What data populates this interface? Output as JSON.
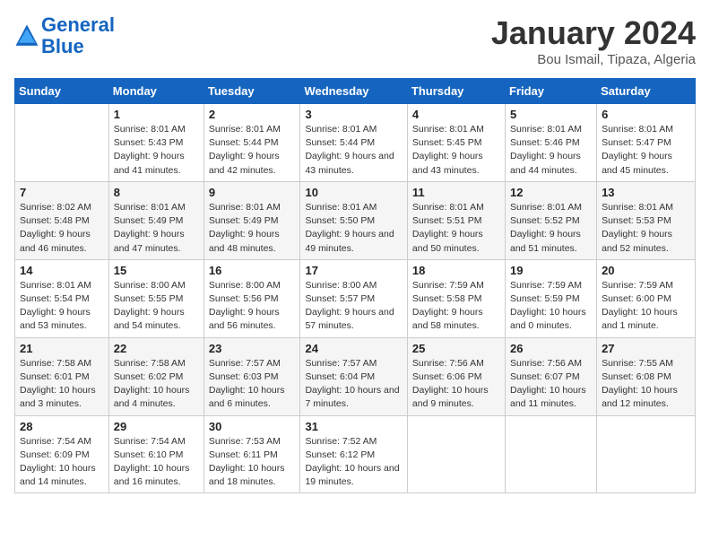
{
  "logo": {
    "line1": "General",
    "line2": "Blue"
  },
  "title": "January 2024",
  "subtitle": "Bou Ismail, Tipaza, Algeria",
  "days_of_week": [
    "Sunday",
    "Monday",
    "Tuesday",
    "Wednesday",
    "Thursday",
    "Friday",
    "Saturday"
  ],
  "weeks": [
    [
      {
        "day": "",
        "sunrise": "",
        "sunset": "",
        "daylight": ""
      },
      {
        "day": "1",
        "sunrise": "Sunrise: 8:01 AM",
        "sunset": "Sunset: 5:43 PM",
        "daylight": "Daylight: 9 hours and 41 minutes."
      },
      {
        "day": "2",
        "sunrise": "Sunrise: 8:01 AM",
        "sunset": "Sunset: 5:44 PM",
        "daylight": "Daylight: 9 hours and 42 minutes."
      },
      {
        "day": "3",
        "sunrise": "Sunrise: 8:01 AM",
        "sunset": "Sunset: 5:44 PM",
        "daylight": "Daylight: 9 hours and 43 minutes."
      },
      {
        "day": "4",
        "sunrise": "Sunrise: 8:01 AM",
        "sunset": "Sunset: 5:45 PM",
        "daylight": "Daylight: 9 hours and 43 minutes."
      },
      {
        "day": "5",
        "sunrise": "Sunrise: 8:01 AM",
        "sunset": "Sunset: 5:46 PM",
        "daylight": "Daylight: 9 hours and 44 minutes."
      },
      {
        "day": "6",
        "sunrise": "Sunrise: 8:01 AM",
        "sunset": "Sunset: 5:47 PM",
        "daylight": "Daylight: 9 hours and 45 minutes."
      }
    ],
    [
      {
        "day": "7",
        "sunrise": "Sunrise: 8:02 AM",
        "sunset": "Sunset: 5:48 PM",
        "daylight": "Daylight: 9 hours and 46 minutes."
      },
      {
        "day": "8",
        "sunrise": "Sunrise: 8:01 AM",
        "sunset": "Sunset: 5:49 PM",
        "daylight": "Daylight: 9 hours and 47 minutes."
      },
      {
        "day": "9",
        "sunrise": "Sunrise: 8:01 AM",
        "sunset": "Sunset: 5:49 PM",
        "daylight": "Daylight: 9 hours and 48 minutes."
      },
      {
        "day": "10",
        "sunrise": "Sunrise: 8:01 AM",
        "sunset": "Sunset: 5:50 PM",
        "daylight": "Daylight: 9 hours and 49 minutes."
      },
      {
        "day": "11",
        "sunrise": "Sunrise: 8:01 AM",
        "sunset": "Sunset: 5:51 PM",
        "daylight": "Daylight: 9 hours and 50 minutes."
      },
      {
        "day": "12",
        "sunrise": "Sunrise: 8:01 AM",
        "sunset": "Sunset: 5:52 PM",
        "daylight": "Daylight: 9 hours and 51 minutes."
      },
      {
        "day": "13",
        "sunrise": "Sunrise: 8:01 AM",
        "sunset": "Sunset: 5:53 PM",
        "daylight": "Daylight: 9 hours and 52 minutes."
      }
    ],
    [
      {
        "day": "14",
        "sunrise": "Sunrise: 8:01 AM",
        "sunset": "Sunset: 5:54 PM",
        "daylight": "Daylight: 9 hours and 53 minutes."
      },
      {
        "day": "15",
        "sunrise": "Sunrise: 8:00 AM",
        "sunset": "Sunset: 5:55 PM",
        "daylight": "Daylight: 9 hours and 54 minutes."
      },
      {
        "day": "16",
        "sunrise": "Sunrise: 8:00 AM",
        "sunset": "Sunset: 5:56 PM",
        "daylight": "Daylight: 9 hours and 56 minutes."
      },
      {
        "day": "17",
        "sunrise": "Sunrise: 8:00 AM",
        "sunset": "Sunset: 5:57 PM",
        "daylight": "Daylight: 9 hours and 57 minutes."
      },
      {
        "day": "18",
        "sunrise": "Sunrise: 7:59 AM",
        "sunset": "Sunset: 5:58 PM",
        "daylight": "Daylight: 9 hours and 58 minutes."
      },
      {
        "day": "19",
        "sunrise": "Sunrise: 7:59 AM",
        "sunset": "Sunset: 5:59 PM",
        "daylight": "Daylight: 10 hours and 0 minutes."
      },
      {
        "day": "20",
        "sunrise": "Sunrise: 7:59 AM",
        "sunset": "Sunset: 6:00 PM",
        "daylight": "Daylight: 10 hours and 1 minute."
      }
    ],
    [
      {
        "day": "21",
        "sunrise": "Sunrise: 7:58 AM",
        "sunset": "Sunset: 6:01 PM",
        "daylight": "Daylight: 10 hours and 3 minutes."
      },
      {
        "day": "22",
        "sunrise": "Sunrise: 7:58 AM",
        "sunset": "Sunset: 6:02 PM",
        "daylight": "Daylight: 10 hours and 4 minutes."
      },
      {
        "day": "23",
        "sunrise": "Sunrise: 7:57 AM",
        "sunset": "Sunset: 6:03 PM",
        "daylight": "Daylight: 10 hours and 6 minutes."
      },
      {
        "day": "24",
        "sunrise": "Sunrise: 7:57 AM",
        "sunset": "Sunset: 6:04 PM",
        "daylight": "Daylight: 10 hours and 7 minutes."
      },
      {
        "day": "25",
        "sunrise": "Sunrise: 7:56 AM",
        "sunset": "Sunset: 6:06 PM",
        "daylight": "Daylight: 10 hours and 9 minutes."
      },
      {
        "day": "26",
        "sunrise": "Sunrise: 7:56 AM",
        "sunset": "Sunset: 6:07 PM",
        "daylight": "Daylight: 10 hours and 11 minutes."
      },
      {
        "day": "27",
        "sunrise": "Sunrise: 7:55 AM",
        "sunset": "Sunset: 6:08 PM",
        "daylight": "Daylight: 10 hours and 12 minutes."
      }
    ],
    [
      {
        "day": "28",
        "sunrise": "Sunrise: 7:54 AM",
        "sunset": "Sunset: 6:09 PM",
        "daylight": "Daylight: 10 hours and 14 minutes."
      },
      {
        "day": "29",
        "sunrise": "Sunrise: 7:54 AM",
        "sunset": "Sunset: 6:10 PM",
        "daylight": "Daylight: 10 hours and 16 minutes."
      },
      {
        "day": "30",
        "sunrise": "Sunrise: 7:53 AM",
        "sunset": "Sunset: 6:11 PM",
        "daylight": "Daylight: 10 hours and 18 minutes."
      },
      {
        "day": "31",
        "sunrise": "Sunrise: 7:52 AM",
        "sunset": "Sunset: 6:12 PM",
        "daylight": "Daylight: 10 hours and 19 minutes."
      },
      {
        "day": "",
        "sunrise": "",
        "sunset": "",
        "daylight": ""
      },
      {
        "day": "",
        "sunrise": "",
        "sunset": "",
        "daylight": ""
      },
      {
        "day": "",
        "sunrise": "",
        "sunset": "",
        "daylight": ""
      }
    ]
  ]
}
